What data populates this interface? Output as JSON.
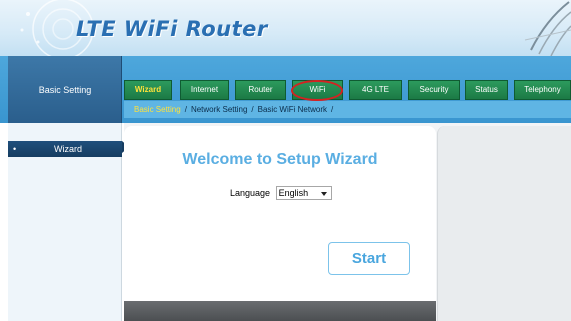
{
  "header": {
    "title": "LTE WiFi Router"
  },
  "left_panel": {
    "label": "Basic Setting"
  },
  "tabs": [
    {
      "label": "Wizard",
      "active": true
    },
    {
      "label": "Internet",
      "active": false
    },
    {
      "label": "Router",
      "active": false
    },
    {
      "label": "WiFi",
      "active": false,
      "highlighted": true
    },
    {
      "label": "4G LTE",
      "active": false
    },
    {
      "label": "Security",
      "active": false
    },
    {
      "label": "Status",
      "active": false
    },
    {
      "label": "Telephony",
      "active": false
    }
  ],
  "breadcrumb": {
    "current": "Basic Setting",
    "items": [
      "Network Setting",
      "Basic WiFi Network"
    ],
    "separator": "/"
  },
  "sidebar": {
    "items": [
      {
        "label": "Wizard",
        "bullet": "•"
      }
    ]
  },
  "main": {
    "welcome_title": "Welcome to Setup Wizard",
    "language_label": "Language",
    "language_value": "English",
    "start_label": "Start"
  },
  "colors": {
    "tab_green": "#1c7a45",
    "active_tab_text": "#ffe23a",
    "band_blue": "#3995cf",
    "title_blue": "#5aaee2",
    "highlight_red": "#d42222"
  }
}
